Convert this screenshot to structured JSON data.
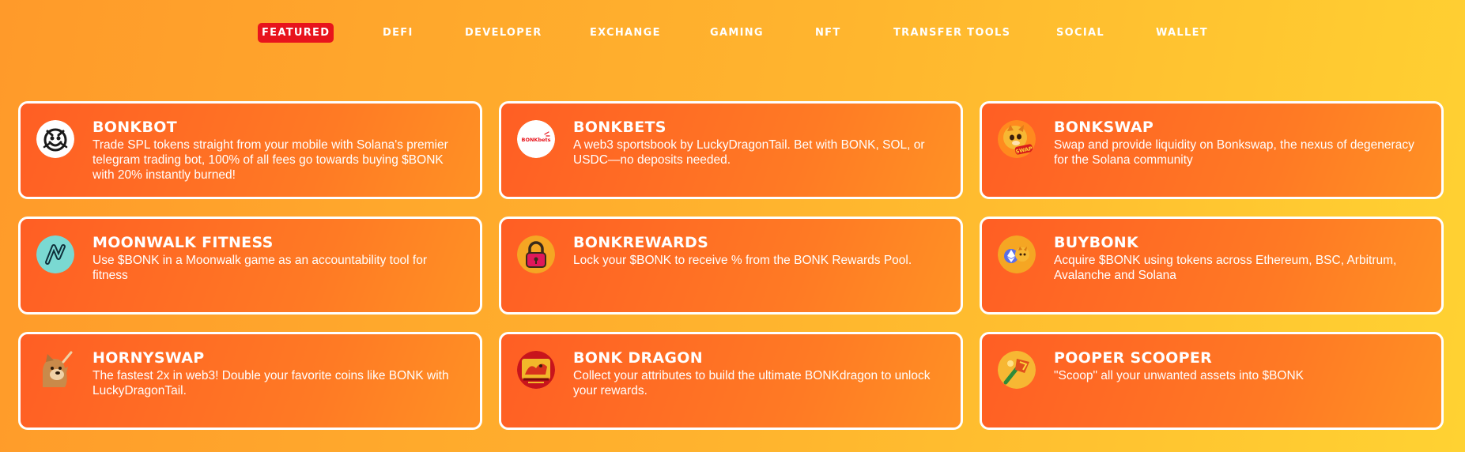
{
  "nav": {
    "tabs": [
      {
        "label": "FEATURED",
        "active": true
      },
      {
        "label": "DEFI",
        "active": false
      },
      {
        "label": "DEVELOPER",
        "active": false
      },
      {
        "label": "EXCHANGE",
        "active": false
      },
      {
        "label": "GAMING",
        "active": false
      },
      {
        "label": "NFT",
        "active": false
      },
      {
        "label": "TRANSFER TOOLS",
        "active": false
      },
      {
        "label": "SOCIAL",
        "active": false
      },
      {
        "label": "WALLET",
        "active": false
      }
    ]
  },
  "cards": [
    {
      "title": "BONKBOT",
      "description": "Trade SPL tokens straight from your mobile with Solana's premier telegram trading bot, 100% of all fees go towards buying $BONK with 20% instantly burned!",
      "icon": "bonkbot-logo-icon"
    },
    {
      "title": "BONKBETS",
      "description": "A web3 sportsbook by LuckyDragonTail. Bet with BONK, SOL, or USDC—no deposits needed.",
      "icon": "bonkbets-logo-icon",
      "logo_text": "BONKbets"
    },
    {
      "title": "BONKSWAP",
      "description": "Swap and provide liquidity on Bonkswap, the nexus of degeneracy for the Solana community",
      "icon": "bonkswap-logo-icon",
      "logo_text": "SWAP"
    },
    {
      "title": "MOONWALK FITNESS",
      "description": "Use $BONK in a Moonwalk game as an accountability tool for fitness",
      "icon": "moonwalk-logo-icon"
    },
    {
      "title": "BONKREWARDS",
      "description": "Lock your $BONK to receive % from the BONK Rewards Pool.",
      "icon": "padlock-icon"
    },
    {
      "title": "BUYBONK",
      "description": "Acquire $BONK using tokens across Ethereum, BSC, Arbitrum, Avalanche and Solana",
      "icon": "buybonk-logo-icon"
    },
    {
      "title": "HORNYSWAP",
      "description": "The fastest 2x in web3! Double your favorite coins like BONK with LuckyDragonTail.",
      "icon": "doge-icon"
    },
    {
      "title": "BONK DRAGON",
      "description": "Collect your attributes to build the ultimate BONKdragon to unlock your rewards.",
      "icon": "dragon-logo-icon"
    },
    {
      "title": "POOPER SCOOPER",
      "description": "\"Scoop\" all your unwanted assets into $BONK",
      "icon": "pooper-scooper-logo-icon"
    }
  ],
  "colors": {
    "active_tab": "#e8141c",
    "card_bg": "#ff6a24",
    "card_border": "#ffffff",
    "page_bg_start": "#ff9a2a",
    "page_bg_end": "#ffd232"
  }
}
